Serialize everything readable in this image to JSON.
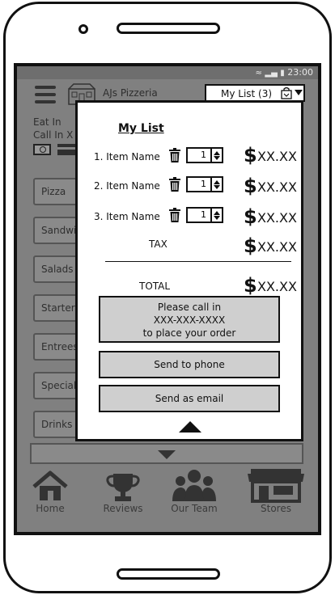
{
  "status_bar": {
    "time": "23:00"
  },
  "header": {
    "restaurant_name": "AJs Pizzeria",
    "my_list_button": "My List (3)"
  },
  "order_type": {
    "eat_in": "Eat In",
    "call_in": "Call In X"
  },
  "categories": [
    "Pizza",
    "Sandwiches",
    "Salads",
    "Starters",
    "Entrees",
    "Specials",
    "Drinks"
  ],
  "my_list": {
    "title": "My List",
    "items": [
      {
        "label": "1. Item Name",
        "qty": "1",
        "currency": "$",
        "price": "XX.XX"
      },
      {
        "label": "2. Item Name",
        "qty": "1",
        "currency": "$",
        "price": "XX.XX"
      },
      {
        "label": "3. Item Name",
        "qty": "1",
        "currency": "$",
        "price": "XX.XX"
      }
    ],
    "tax_label": "TAX",
    "tax_currency": "$",
    "tax_value": "XX.XX",
    "total_label": "TOTAL",
    "total_currency": "$",
    "total_value": "XX.XX",
    "call_message": {
      "line1": "Please call in",
      "line2": "XXX-XXX-XXXX",
      "line3": "to place your order"
    },
    "send_to_phone": "Send to phone",
    "send_as_email": "Send as email"
  },
  "bottom_nav": [
    {
      "label": "Home",
      "icon": "home-icon"
    },
    {
      "label": "Reviews",
      "icon": "trophy-icon"
    },
    {
      "label": "Our Team",
      "icon": "team-icon"
    },
    {
      "label": "Stores",
      "icon": "store-icon"
    }
  ],
  "colors": {
    "overlay_gray": "#808080",
    "popup_bg": "#ffffff",
    "button_gray": "#cfcfcf",
    "ink": "#111111"
  }
}
